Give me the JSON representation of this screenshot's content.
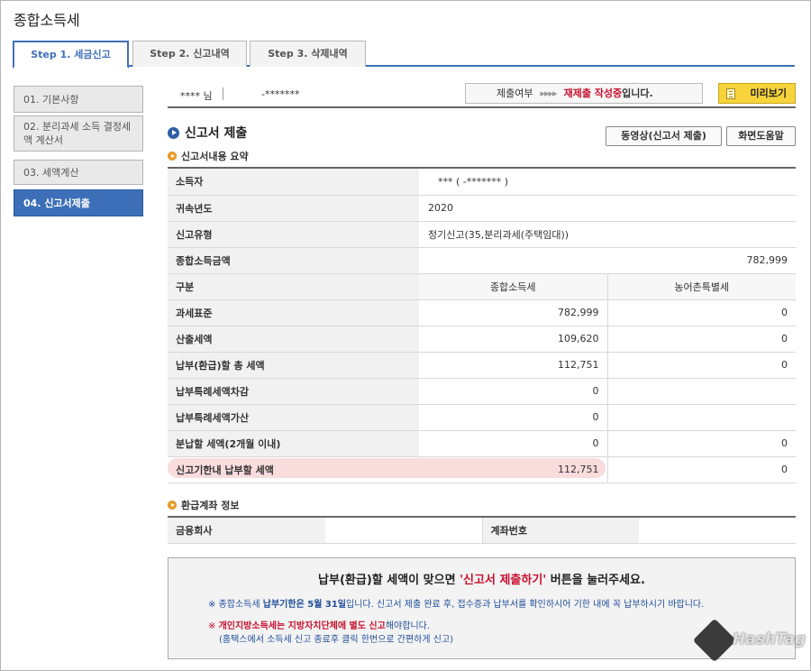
{
  "page": {
    "title": "종합소득세"
  },
  "tabs": [
    {
      "label": "Step 1. 세금신고"
    },
    {
      "label": "Step 2. 신고내역"
    },
    {
      "label": "Step 3. 삭제내역"
    }
  ],
  "sidebar": {
    "items": [
      {
        "label": "01. 기본사항"
      },
      {
        "label": "02. 분리과세 소득 결정세액 계산서"
      },
      {
        "label": "03. 세액계산"
      },
      {
        "label": "04. 신고서제출"
      }
    ]
  },
  "info_bar": {
    "name": "**** 님",
    "id_masked": "-*******",
    "status_label": "제출여부",
    "status_arrows": "▸▸▸▸",
    "status_value_red": "재제출 작성중",
    "status_value_suffix": "입니다.",
    "preview_label": "미리보기"
  },
  "section": {
    "title": "신고서 제출",
    "video_button": "동영상(신고서 제출)",
    "help_button": "화면도움말"
  },
  "summary": {
    "title": "신고서내용 요약",
    "rows": [
      {
        "label": "소득자",
        "value": "***  (           -*******  )"
      },
      {
        "label": "귀속년도",
        "value": "2020"
      },
      {
        "label": "신고유형",
        "value": "정기신고(35,분리과세(주택임대))"
      },
      {
        "label": "종합소득금액",
        "value": "782,999"
      }
    ],
    "header": {
      "label": "구분",
      "col1": "종합소득세",
      "col2": "농어촌특별세"
    },
    "tax_rows": [
      {
        "label": "과세표준",
        "col1": "782,999",
        "col2": "0"
      },
      {
        "label": "산출세액",
        "col1": "109,620",
        "col2": "0"
      },
      {
        "label": "납부(환급)할 총 세액",
        "col1": "112,751",
        "col2": "0"
      },
      {
        "label": "납부특례세액차감",
        "col1": "0",
        "col2": ""
      },
      {
        "label": "납부특례세액가산",
        "col1": "0",
        "col2": ""
      },
      {
        "label": "분납할 세액(2개월 이내)",
        "col1": "0",
        "col2": "0"
      },
      {
        "label": "신고기한내 납부할 세액",
        "col1": "112,751",
        "col2": "0"
      }
    ]
  },
  "refund": {
    "title": "환급계좌 정보",
    "bank_label": "금융회사",
    "bank_value": "",
    "account_label": "계좌번호",
    "account_value": ""
  },
  "notice": {
    "main_prefix": "납부(환급)할 세액이 맞으면 ",
    "main_red": "'신고서 제출하기'",
    "main_suffix": " 버튼을 눌러주세요.",
    "line1_star": "※",
    "line1_a": "종합소득세 ",
    "line1_b": "납부기한은 5월 31일",
    "line1_c": "입니다. 신고서 제출 완료 후, 접수증과 납부서를 확인하시어 기한 내에 꼭 납부하시기 바랍니다.",
    "line2_star": "※",
    "line2_a": "개인지방소득세는 ",
    "line2_b": "지방자치단체에 별도 신고",
    "line2_c": "해야합니다.",
    "line3": "(홈택스에서 소득세 신고 종료후 클릭 한번으로 간편하게 신고)"
  },
  "watermark": {
    "text": "HashTag"
  },
  "colors": {
    "accent": "#3c6fb7",
    "red": "#c8102e",
    "highlight": "#f9dcdc",
    "preview": "#f7d33c"
  }
}
